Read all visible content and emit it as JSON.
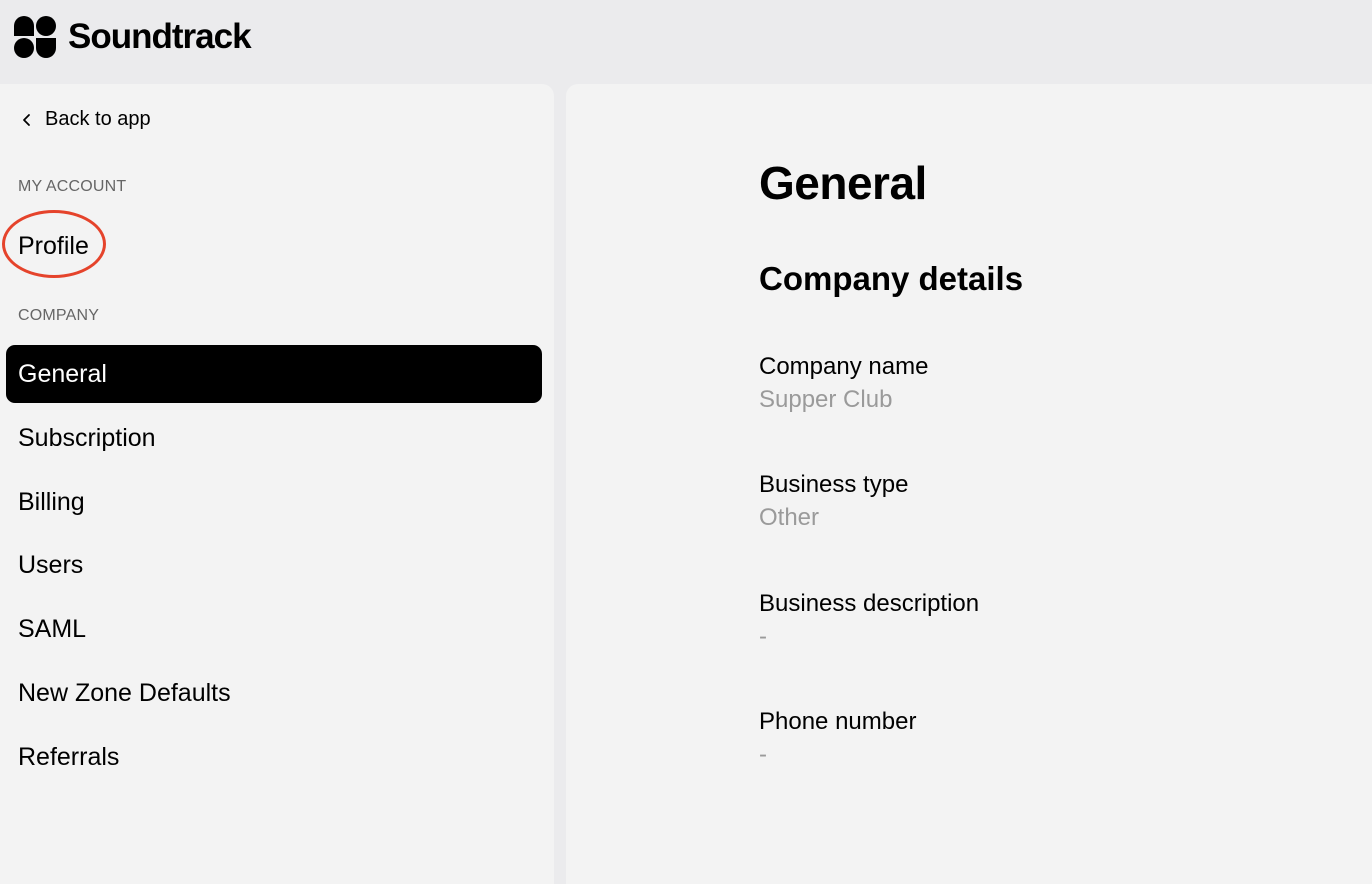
{
  "brand": {
    "name": "Soundtrack",
    "logo_icon": "soundtrack-logo-icon"
  },
  "sidebar": {
    "back_label": "Back to app",
    "back_icon": "chevron-left-icon",
    "my_account_heading": "MY ACCOUNT",
    "my_account_items": [
      {
        "label": "Profile"
      }
    ],
    "company_heading": "COMPANY",
    "company_items": [
      {
        "label": "General",
        "active": true
      },
      {
        "label": "Subscription"
      },
      {
        "label": "Billing"
      },
      {
        "label": "Users"
      },
      {
        "label": "SAML"
      },
      {
        "label": "New Zone Defaults"
      },
      {
        "label": "Referrals"
      }
    ]
  },
  "main": {
    "title": "General",
    "section_title": "Company details",
    "fields": [
      {
        "label": "Company name",
        "value": "Supper Club"
      },
      {
        "label": "Business type",
        "value": "Other"
      },
      {
        "label": "Business description",
        "value": "-"
      },
      {
        "label": "Phone number",
        "value": "-"
      }
    ]
  },
  "colors": {
    "active_bg": "#000000",
    "highlight_ring": "#e5432b",
    "muted_value": "#9a9a9a"
  }
}
